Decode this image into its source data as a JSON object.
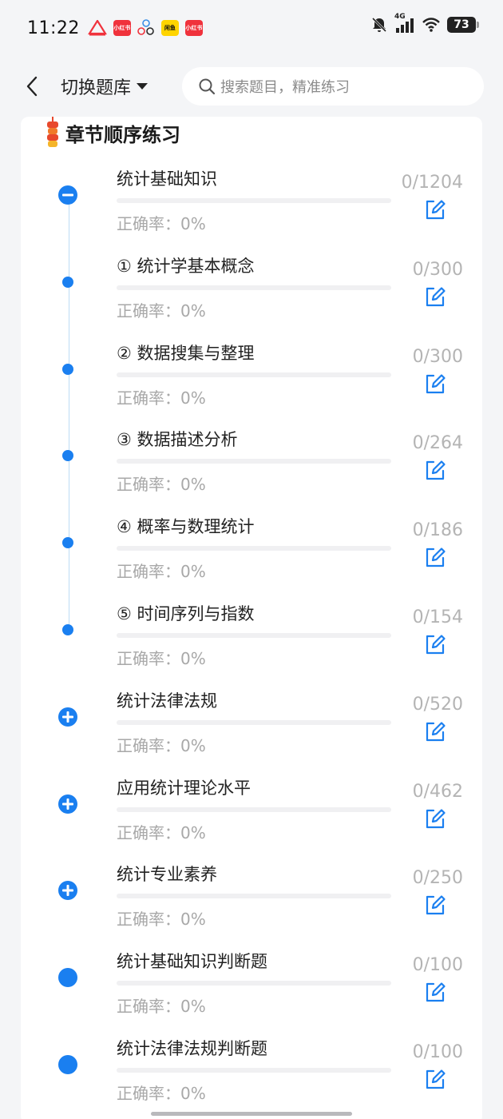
{
  "status_bar": {
    "time": "11:22",
    "notif_apps": [
      "小红书",
      "闲鱼",
      "小红书"
    ],
    "network": "4G",
    "battery": "73"
  },
  "header": {
    "bank_switch_label": "切换题库",
    "search_placeholder": "搜索题目，精准练习"
  },
  "section": {
    "title": "章节顺序练习"
  },
  "colors": {
    "accent": "#1a7ff0",
    "muted_text": "#a8a8a8",
    "count_text": "#b4b4b4"
  },
  "items": [
    {
      "title": "统计基础知识",
      "accuracy": "正确率：0%",
      "count": "0/1204",
      "marker": "collapse",
      "progress": 0
    },
    {
      "title": "① 统计学基本概念",
      "accuracy": "正确率：0%",
      "count": "0/300",
      "marker": "dot",
      "progress": 0
    },
    {
      "title": "② 数据搜集与整理",
      "accuracy": "正确率：0%",
      "count": "0/300",
      "marker": "dot",
      "progress": 0
    },
    {
      "title": "③ 数据描述分析",
      "accuracy": "正确率：0%",
      "count": "0/264",
      "marker": "dot",
      "progress": 0
    },
    {
      "title": "④ 概率与数理统计",
      "accuracy": "正确率：0%",
      "count": "0/186",
      "marker": "dot",
      "progress": 0
    },
    {
      "title": "⑤ 时间序列与指数",
      "accuracy": "正确率：0%",
      "count": "0/154",
      "marker": "dot",
      "progress": 0
    },
    {
      "title": "统计法律法规",
      "accuracy": "正确率：0%",
      "count": "0/520",
      "marker": "expand",
      "progress": 0
    },
    {
      "title": "应用统计理论水平",
      "accuracy": "正确率：0%",
      "count": "0/462",
      "marker": "expand",
      "progress": 0
    },
    {
      "title": "统计专业素养",
      "accuracy": "正确率：0%",
      "count": "0/250",
      "marker": "expand",
      "progress": 0
    },
    {
      "title": "统计基础知识判断题",
      "accuracy": "正确率：0%",
      "count": "0/100",
      "marker": "solid",
      "progress": 0
    },
    {
      "title": "统计法律法规判断题",
      "accuracy": "正确率：0%",
      "count": "0/100",
      "marker": "solid",
      "progress": 0
    }
  ]
}
